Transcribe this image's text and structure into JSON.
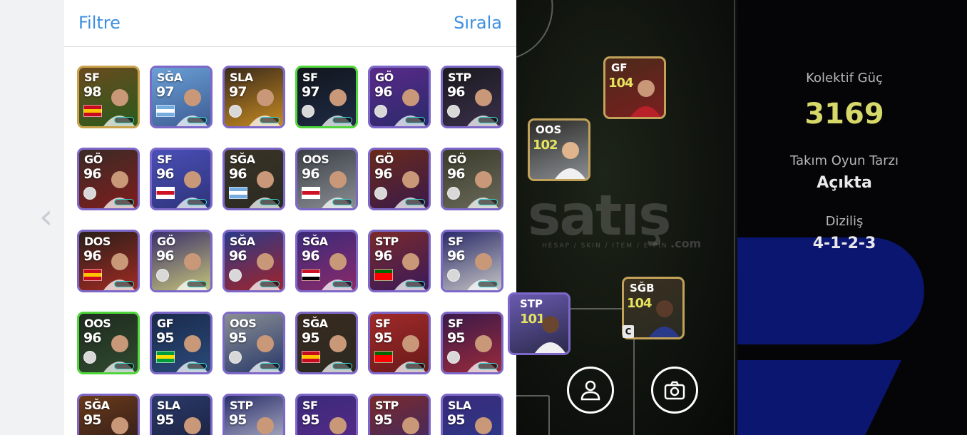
{
  "header": {
    "filter_label": "Filtre",
    "sort_label": "Sırala"
  },
  "players": [
    {
      "pos": "SF",
      "rating": "98",
      "flag": "es",
      "bg": [
        "#6b4a1e",
        "#2a5b1d"
      ],
      "border": "#c9a24a"
    },
    {
      "pos": "SĞA",
      "rating": "97",
      "flag": "ar",
      "bg": [
        "#6aa0d6",
        "#3d5c93"
      ],
      "border": "#7d68c9"
    },
    {
      "pos": "SLA",
      "rating": "97",
      "flag": "rm",
      "bg": [
        "#3a2a1a",
        "#c58a22"
      ],
      "border": "#7d68c9"
    },
    {
      "pos": "SF",
      "rating": "97",
      "flag": "psg",
      "bg": [
        "#12161c",
        "#1e2b45"
      ],
      "border": "#4fd63a"
    },
    {
      "pos": "GÖ",
      "rating": "96",
      "flag": "psg",
      "bg": [
        "#5a2a8a",
        "#2a2a6a"
      ],
      "border": "#7d68c9"
    },
    {
      "pos": "STP",
      "rating": "96",
      "flag": "ars",
      "bg": [
        "#1a1a1f",
        "#3a2f4a"
      ],
      "border": "#7d68c9"
    },
    {
      "pos": "GÖ",
      "rating": "96",
      "flag": "ars",
      "bg": [
        "#3a2b26",
        "#7e1d1d"
      ],
      "border": "#7d68c9"
    },
    {
      "pos": "SF",
      "rating": "96",
      "flag": "en",
      "bg": [
        "#4a4fb7",
        "#2e347a"
      ],
      "border": "#7d68c9"
    },
    {
      "pos": "SĞA",
      "rating": "96",
      "flag": "ar",
      "bg": [
        "#3a3326",
        "#2a2a22"
      ],
      "border": "#7d68c9"
    },
    {
      "pos": "OOS",
      "rating": "96",
      "flag": "en",
      "bg": [
        "#3a3f46",
        "#8a8e93"
      ],
      "border": "#7d68c9"
    },
    {
      "pos": "GÖ",
      "rating": "96",
      "flag": "fcb",
      "bg": [
        "#6a2a1a",
        "#3a1a4a"
      ],
      "border": "#7d68c9"
    },
    {
      "pos": "GÖ",
      "rating": "96",
      "flag": "rm",
      "bg": [
        "#3a3a2a",
        "#6a6a5a"
      ],
      "border": "#7d68c9"
    },
    {
      "pos": "DOS",
      "rating": "96",
      "flag": "es",
      "bg": [
        "#2a1f1a",
        "#a02a22"
      ],
      "border": "#7d68c9"
    },
    {
      "pos": "GÖ",
      "rating": "96",
      "flag": "fcb",
      "bg": [
        "#3a2f6a",
        "#c4c27a"
      ],
      "border": "#7d68c9"
    },
    {
      "pos": "SĞA",
      "rating": "96",
      "flag": "bay",
      "bg": [
        "#2a3a8a",
        "#a0242a"
      ],
      "border": "#7d68c9"
    },
    {
      "pos": "SĞA",
      "rating": "96",
      "flag": "eg",
      "bg": [
        "#3a2a7a",
        "#8a2a6a"
      ],
      "border": "#7d68c9"
    },
    {
      "pos": "STP",
      "rating": "96",
      "flag": "pt",
      "bg": [
        "#7a2a2a",
        "#3a1a5a"
      ],
      "border": "#7d68c9"
    },
    {
      "pos": "SF",
      "rating": "96",
      "flag": "ata",
      "bg": [
        "#2a2a6a",
        "#c4c4c4"
      ],
      "border": "#7d68c9"
    },
    {
      "pos": "OOS",
      "rating": "96",
      "flag": "rm",
      "bg": [
        "#1f2a1f",
        "#2f4a2f"
      ],
      "border": "#4fd63a"
    },
    {
      "pos": "GF",
      "rating": "95",
      "flag": "br",
      "bg": [
        "#1a2a4a",
        "#2a4a7a"
      ],
      "border": "#7d68c9"
    },
    {
      "pos": "OOS",
      "rating": "95",
      "flag": "int",
      "bg": [
        "#8a8e93",
        "#2a3a6a"
      ],
      "border": "#7d68c9"
    },
    {
      "pos": "SĞA",
      "rating": "95",
      "flag": "es",
      "bg": [
        "#3a2a1f",
        "#2a2a22"
      ],
      "border": "#7d68c9"
    },
    {
      "pos": "SF",
      "rating": "95",
      "flag": "pt",
      "bg": [
        "#a02a2a",
        "#6a1a1a"
      ],
      "border": "#7d68c9"
    },
    {
      "pos": "SF",
      "rating": "95",
      "flag": "avl",
      "bg": [
        "#3a1a4a",
        "#9a2a3a"
      ],
      "border": "#7d68c9"
    },
    {
      "pos": "SĞA",
      "rating": "95",
      "flag": "none",
      "bg": [
        "#6a3a1a",
        "#2a1a1a"
      ],
      "border": "#7d68c9"
    },
    {
      "pos": "SLA",
      "rating": "95",
      "flag": "none",
      "bg": [
        "#2a3a6a",
        "#1a1f3a"
      ],
      "border": "#7d68c9"
    },
    {
      "pos": "STP",
      "rating": "95",
      "flag": "none",
      "bg": [
        "#2a2f6a",
        "#c4c4d4"
      ],
      "border": "#7d68c9"
    },
    {
      "pos": "SF",
      "rating": "95",
      "flag": "none",
      "bg": [
        "#3a2a7a",
        "#5a2a8a"
      ],
      "border": "#7d68c9"
    },
    {
      "pos": "STP",
      "rating": "95",
      "flag": "none",
      "bg": [
        "#7a2a2a",
        "#3a2a6a"
      ],
      "border": "#7d68c9"
    },
    {
      "pos": "SLA",
      "rating": "95",
      "flag": "none",
      "bg": [
        "#3a2a7a",
        "#2a3a8a"
      ],
      "border": "#7d68c9"
    }
  ],
  "formation_cards": [
    {
      "pos": "GF",
      "rating": "104"
    },
    {
      "pos": "OOS",
      "rating": "102"
    },
    {
      "pos": "STP",
      "rating": "101"
    },
    {
      "pos": "SĞB",
      "rating": "104"
    }
  ],
  "captain_badge": "C",
  "watermark": {
    "text": "satış",
    "sub": "HESAP / SKIN / ITEM / E-PIN",
    "com": ".com"
  },
  "team_stats": {
    "power_label": "Kolektif Güç",
    "power_value": "3169",
    "style_label": "Takım Oyun Tarzı",
    "style_value": "Açıkta",
    "formation_label": "Diziliş",
    "formation_value": "4-1-2-3"
  },
  "colors": {
    "accent": "#3d8fe0",
    "power": "#d6d96a",
    "deco_blue": "#0b1670"
  }
}
